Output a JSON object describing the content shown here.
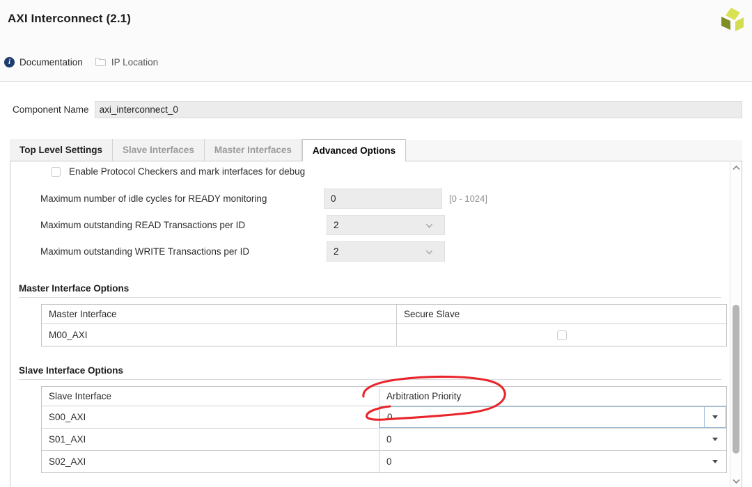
{
  "window": {
    "title": "AXI Interconnect (2.1)",
    "logo_name": "xilinx-logo",
    "logo_colors": [
      "#d6e04a",
      "#cddb4a",
      "#7d8b1e"
    ]
  },
  "header_links": [
    {
      "label": "Documentation",
      "icon": "info-icon"
    },
    {
      "label": "IP Location",
      "icon": "folder-icon"
    }
  ],
  "component": {
    "label": "Component Name",
    "value": "axi_interconnect_0",
    "placeholder": ""
  },
  "tabs": [
    {
      "label": "Top Level Settings",
      "state": "normal"
    },
    {
      "label": "Slave Interfaces",
      "state": "muted"
    },
    {
      "label": "Master Interfaces",
      "state": "muted"
    },
    {
      "label": "Advanced Options",
      "state": "active"
    }
  ],
  "advanced": {
    "protocol_checkers": {
      "label": "Enable Protocol Checkers and mark interfaces for debug",
      "checked": false
    },
    "fields": [
      {
        "label": "Maximum number of idle cycles for READY monitoring",
        "value": "0",
        "type": "text",
        "hint": "[0 - 1024]"
      },
      {
        "label": "Maximum outstanding READ Transactions per ID",
        "value": "2",
        "type": "combo",
        "hint": ""
      },
      {
        "label": "Maximum outstanding WRITE Transactions per ID",
        "value": "2",
        "type": "combo",
        "hint": ""
      }
    ],
    "master_section": {
      "title": "Master Interface Options",
      "columns": [
        "Master Interface",
        "Secure Slave"
      ],
      "rows": [
        {
          "interface": "M00_AXI",
          "secure_slave": false
        }
      ]
    },
    "slave_section": {
      "title": "Slave Interface Options",
      "columns": [
        "Slave Interface",
        "Arbitration Priority"
      ],
      "rows": [
        {
          "interface": "S00_AXI",
          "priority": "0",
          "editing": true
        },
        {
          "interface": "S01_AXI",
          "priority": "0",
          "editing": false
        },
        {
          "interface": "S02_AXI",
          "priority": "0",
          "editing": false
        }
      ]
    }
  },
  "scrollbar": {
    "up_icon": "chevron-up-icon",
    "down_icon": "chevron-down-icon"
  },
  "annotation": {
    "color": "#e8252a",
    "target": "Arbitration Priority",
    "shape": "hand-drawn-ellipse"
  }
}
